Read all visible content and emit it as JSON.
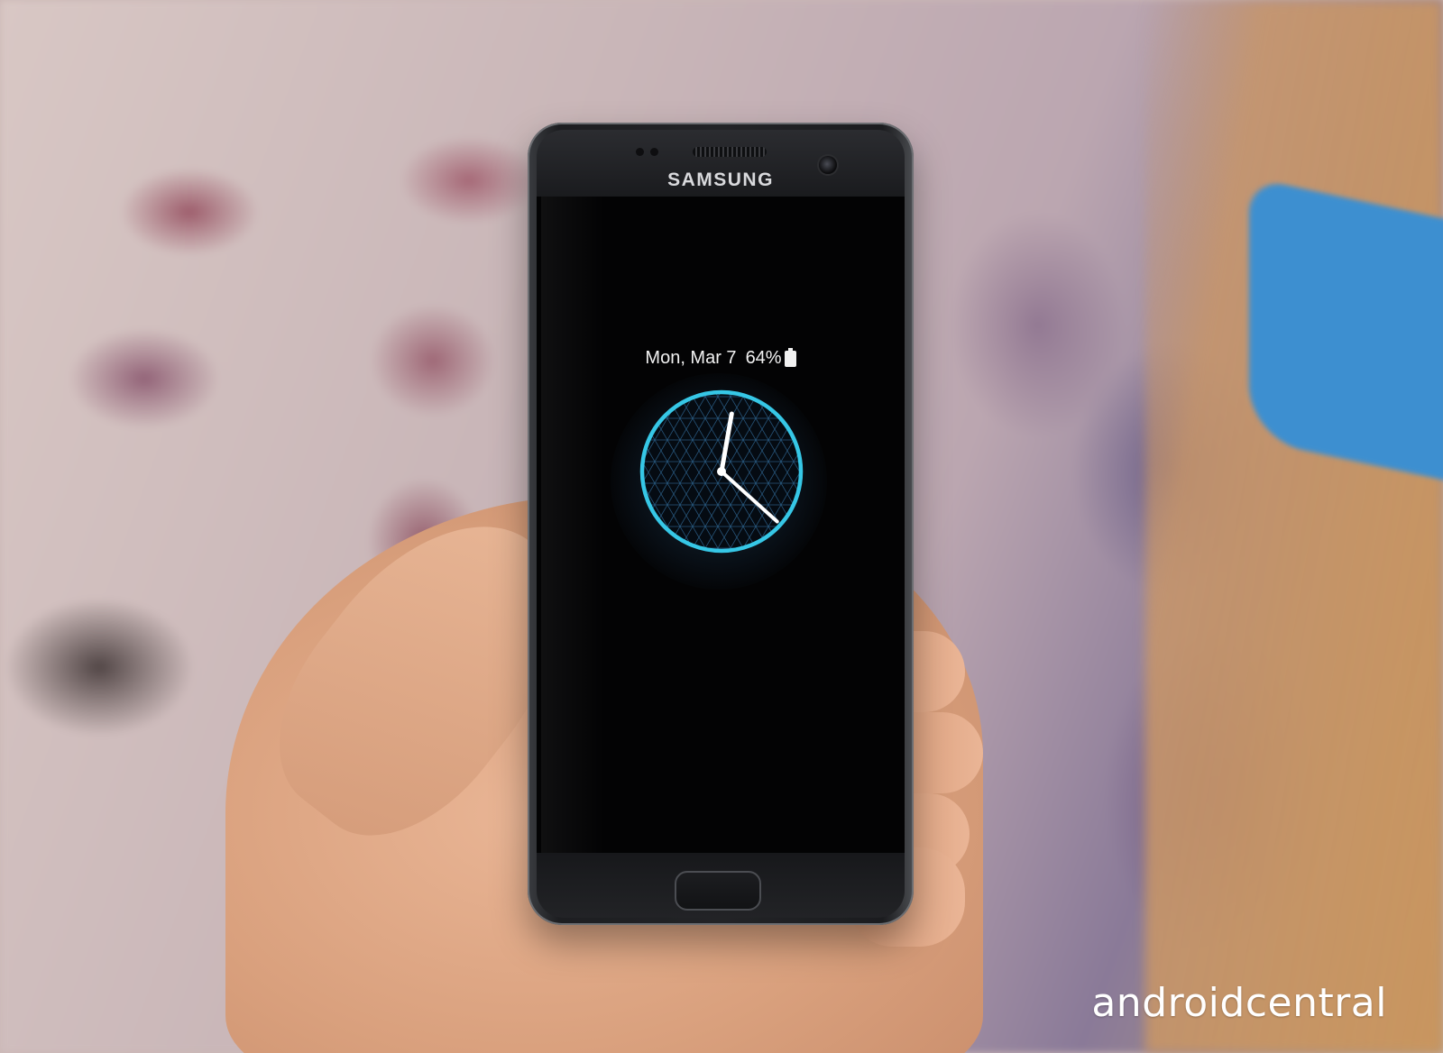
{
  "phone": {
    "brand": "SAMSUNG"
  },
  "always_on_display": {
    "date": "Mon, Mar 7",
    "battery": "64%",
    "battery_icon": "battery-icon",
    "clock": {
      "hour_hand_deg": 10,
      "minute_hand_deg": 132,
      "ring_color": "#36c7e6"
    }
  },
  "watermark": {
    "text": "androidcentral"
  }
}
